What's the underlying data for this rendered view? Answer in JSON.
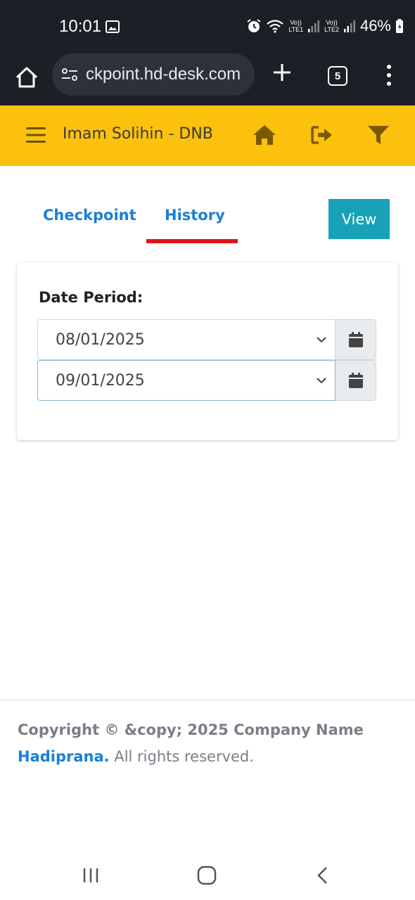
{
  "status_bar": {
    "time": "10:01",
    "battery": "46%",
    "sim1": "LTE1",
    "sim2": "LTE2",
    "icons": [
      "image-icon",
      "alarm-icon",
      "wifi-icon",
      "signal-icon",
      "battery-icon"
    ]
  },
  "browser": {
    "url": "ckpoint.hd-desk.com",
    "tab_count": "5"
  },
  "header": {
    "title": "Imam Solihin - DNB",
    "accent": "#fcc10c"
  },
  "tabs": [
    {
      "label": "Checkpoint",
      "active": false
    },
    {
      "label": "History",
      "active": true
    }
  ],
  "view_button": "View",
  "date_card": {
    "label": "Date Period:",
    "start_date": "08/01/2025",
    "end_date": "09/01/2025"
  },
  "footer": {
    "copyright": "Copyright © &copy; 2025 Company Name",
    "company": "Hadiprana.",
    "rights": "All rights reserved."
  }
}
